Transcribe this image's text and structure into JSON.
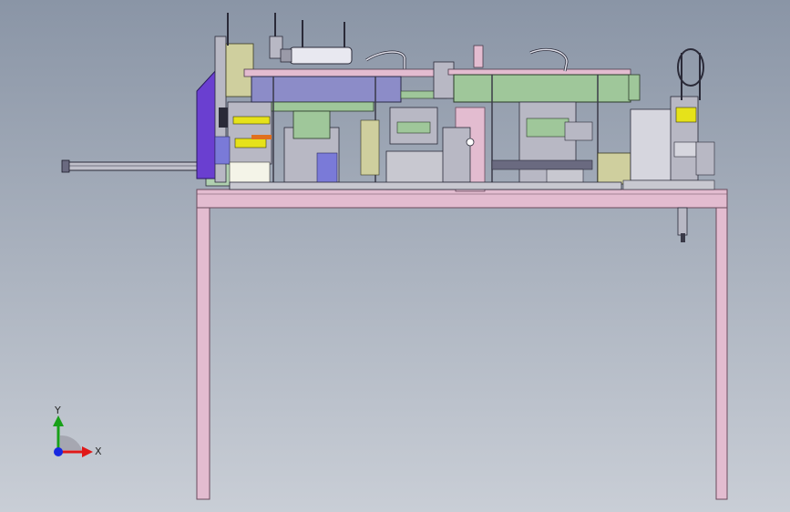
{
  "viewport": {
    "background_top": "#8a95a6",
    "background_bottom": "#c9ced6"
  },
  "triad": {
    "y_label": "Y",
    "x_label": "X",
    "y_color": "#18a018",
    "x_color": "#e01818",
    "z_color": "#1828e0"
  },
  "colors": {
    "frame_pink": "#e3bcd0",
    "frame_edge": "#6a4a5c",
    "purple_block": "#6a3fd0",
    "green_plate": "#9fc79a",
    "violet_plate": "#8c8cc8",
    "yellow_part": "#e6e21a",
    "metal": "#b8b8c4",
    "dark_metal": "#3a3a48",
    "olive_panel": "#cfcf9e",
    "grey_box": "#c8c8d0"
  }
}
